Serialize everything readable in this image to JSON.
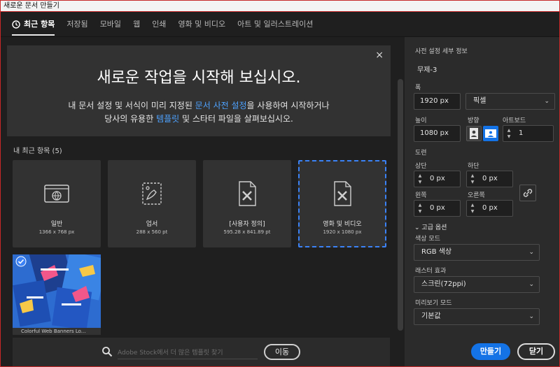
{
  "window": {
    "title": "새로운 문서 만들기"
  },
  "tabs": [
    {
      "label": "최근 항목"
    },
    {
      "label": "저장됨"
    },
    {
      "label": "모바일"
    },
    {
      "label": "웹"
    },
    {
      "label": "인쇄"
    },
    {
      "label": "영화 및 비디오"
    },
    {
      "label": "아트 및 일러스트레이션"
    }
  ],
  "banner": {
    "headline": "새로운 작업을 시작해 보십시오.",
    "line1_a": "내 문서 설정 및 서식이 미리 지정된 ",
    "line1_link": "문서 사전 설정",
    "line1_b": "을 사용하여 시작하거나",
    "line2_a": "당사의 유용한 ",
    "line2_link": "템플릿",
    "line2_b": " 및 스타터 파일을 살펴보십시오.",
    "close": "×"
  },
  "recent": {
    "title": "내 최근 항목",
    "count": "(5)",
    "items": [
      {
        "name": "일반",
        "size": "1366 x 768 px",
        "icon": "web-icon"
      },
      {
        "name": "업서",
        "size": "288 x 560 pt",
        "icon": "postcard-icon"
      },
      {
        "name": "[사용자 정의]",
        "size": "595.28 x 841.89 pt",
        "icon": "custom-doc-icon"
      },
      {
        "name": "영화 및 비디오",
        "size": "1920 x 1080 px",
        "icon": "video-doc-icon"
      }
    ],
    "template_caption": "Colorful Web Banners Lo..."
  },
  "search": {
    "placeholder": "Adobe Stock에서 더 많은 템플릿 찾기",
    "go": "이동"
  },
  "preset": {
    "section_title": "사전 설정 세부 정보",
    "name": "무제-3",
    "width_label": "폭",
    "width": "1920 px",
    "unit": "픽셀",
    "height_label": "높이",
    "height": "1080 px",
    "orientation_label": "방향",
    "artboard_label": "아트보드",
    "artboard": "1",
    "bleed_label": "도련",
    "top_label": "상단",
    "top": "0 px",
    "bottom_label": "하단",
    "bottom": "0 px",
    "left_label": "왼쪽",
    "left": "0 px",
    "right_label": "오른쪽",
    "right": "0 px",
    "advanced": "고급 옵션",
    "colormode_label": "색상 모드",
    "colormode": "RGB 색상",
    "raster_label": "래스터 효과",
    "raster": "스크린(72ppi)",
    "preview_label": "미리보기 모드",
    "preview": "기본값"
  },
  "buttons": {
    "create": "만들기",
    "close": "닫기"
  },
  "colors": {
    "accent": "#1473e6",
    "link": "#4ea2ff"
  }
}
